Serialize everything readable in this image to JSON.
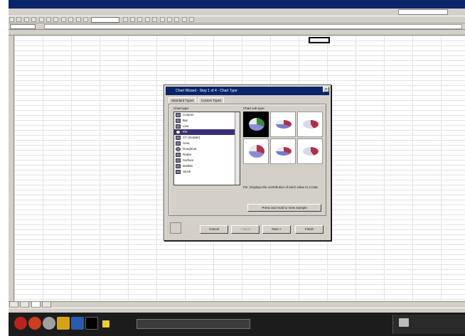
{
  "chart_wizard": {
    "title": "Chart Wizard - Step 1 of 4 - Chart Type",
    "tabs": [
      "Standard Types",
      "Custom Types"
    ],
    "chart_type_label": "Chart type:",
    "chart_sub_type_label": "Chart sub-type:",
    "chart_types": [
      {
        "label": "Column",
        "selected": false
      },
      {
        "label": "Bar",
        "selected": false
      },
      {
        "label": "Line",
        "selected": false
      },
      {
        "label": "Pie",
        "selected": true
      },
      {
        "label": "XY (Scatter)",
        "selected": false
      },
      {
        "label": "Area",
        "selected": false
      },
      {
        "label": "Doughnut",
        "selected": false
      },
      {
        "label": "Radar",
        "selected": false
      },
      {
        "label": "Surface",
        "selected": false
      },
      {
        "label": "Bubble",
        "selected": false
      },
      {
        "label": "Stock",
        "selected": false
      }
    ],
    "description": "Pie. Displays the contribution of each value to a total.",
    "press_and_hold": "Press and Hold to View Sample",
    "buttons": {
      "cancel": "Cancel",
      "back": "< Back",
      "next": "Next >",
      "finish": "Finish"
    }
  },
  "sheet": {
    "colors": {
      "selected_row": "#3a2f77",
      "title_bar": "#0a246a"
    }
  }
}
